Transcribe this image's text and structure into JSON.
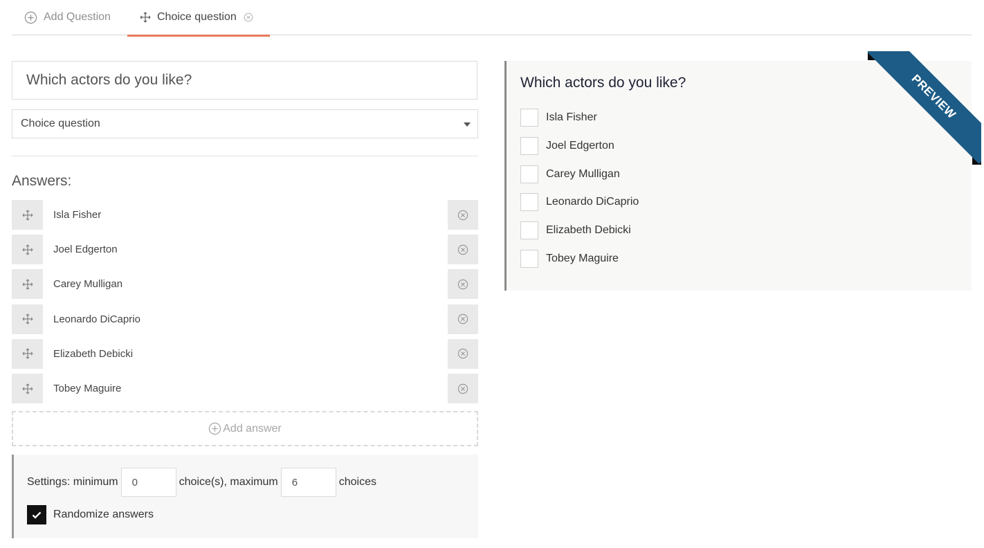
{
  "tabs": {
    "add_label": "Add Question",
    "choice_label": "Choice question",
    "active_accent": "#e8795a"
  },
  "editor": {
    "question_value": "Which actors do you like?",
    "type_select_value": "Choice question",
    "answers_label": "Answers:",
    "answers": [
      "Isla Fisher",
      "Joel Edgerton",
      "Carey Mulligan",
      "Leonardo DiCaprio",
      "Elizabeth Debicki",
      "Tobey Maguire"
    ],
    "add_answer_label": "Add answer",
    "settings": {
      "prefix": "Settings: minimum",
      "min_value": "0",
      "middle": "choice(s), maximum",
      "max_value": "6",
      "suffix": "choices",
      "randomize_label": "Randomize answers",
      "randomize_checked": true
    }
  },
  "preview": {
    "title": "Which actors do you like?",
    "options": [
      "Isla Fisher",
      "Joel Edgerton",
      "Carey Mulligan",
      "Leonardo DiCaprio",
      "Elizabeth Debicki",
      "Tobey Maguire"
    ],
    "ribbon_label": "PREVIEW",
    "ribbon_color": "#1d5c86"
  }
}
